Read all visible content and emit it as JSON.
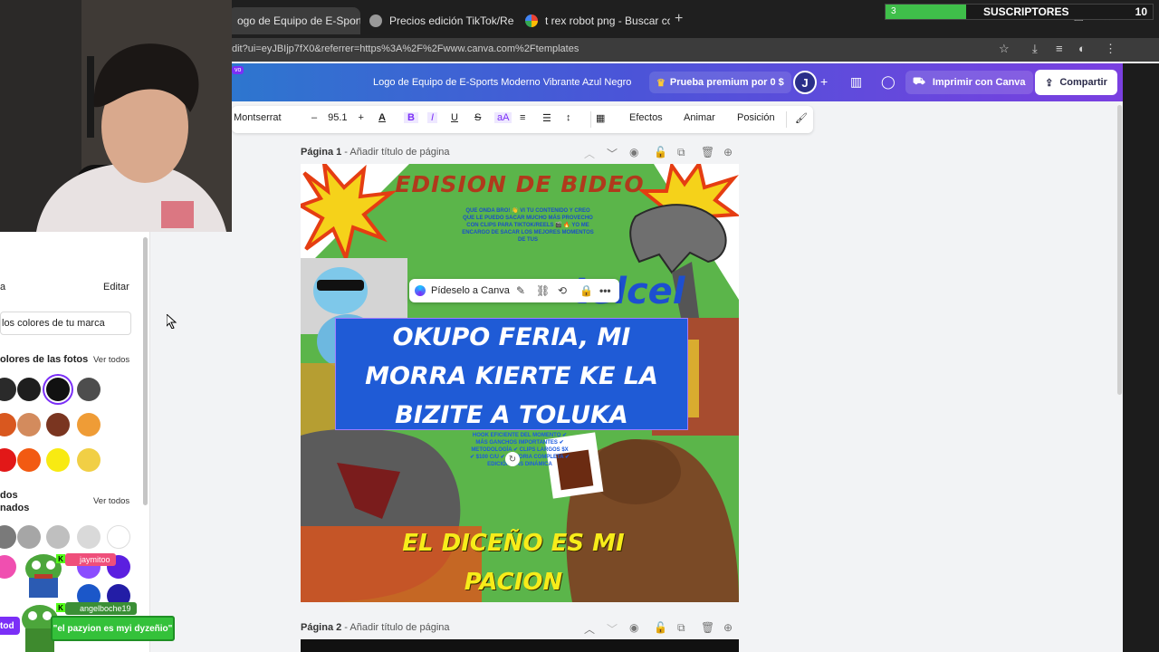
{
  "browser": {
    "tabs": [
      {
        "title": "ogo de Equipo de E-Sports M",
        "active": true
      },
      {
        "title": "Precios edición TikTok/Reels",
        "active": false
      },
      {
        "title": "t rex robot png - Buscar con Go",
        "active": false
      }
    ],
    "url": "dit?ui=eyJBIjp7fX0&referrer=https%3A%2F%2Fwww.canva.com%2Ftemplates"
  },
  "header": {
    "new_badge": "vo",
    "doc_title": "Logo de Equipo de E-Sports Moderno Vibrante Azul Negro",
    "premium_label": "Prueba premium por 0 $",
    "avatar_letter": "J",
    "print_label": "Imprimir con Canva",
    "share_label": "Compartir"
  },
  "toolbar": {
    "font": "Montserrat",
    "font_size": "95.1",
    "effects": "Efectos",
    "animate": "Animar",
    "position": "Posición"
  },
  "panel": {
    "edit_label": "Editar",
    "brand_colors": "los colores de tu marca",
    "photo_colors_title": "olores de las fotos",
    "view_all_1": "Ver todos",
    "all_title_1": "dos",
    "all_title_2": "nados",
    "view_all_2": "Ver todos",
    "bottom_btn": "tod"
  },
  "pages": {
    "page1_label": "Página 1",
    "page1_add": "Añadir título de página",
    "page2_label": "Página 2",
    "page2_add": "Añadir título de página"
  },
  "design": {
    "headline": "EDISION DE BIDEO",
    "small_text": "QUE ONDA BRO! 👋 VI TU CONTENIDO Y CREO QUE LE PUEDO SACAR MUCHO MÁS PROVECHO CON CLIPS PARA TIKTOK/REELS 🎬 🔥 YO ME ENCARGO DE SACAR LOS MEJORES MOMENTOS DE TUS",
    "telcel": "telcel",
    "main_line1": "OKUPO FERIA, MI",
    "main_line2": "MORRA KIERTE KE LA",
    "main_line3": "BIZITE A TOLUKA",
    "list_text": "HOOK EFICIENTE DEL MOMENTO ✔ MÁS GANCHOS IMPORTANTES ✔ METODOLOGÍA ✔ CLIPS LARGOS $X ✔ $100 C/U ✔ HISTORIA COMPLETA ✔ EDICIÓN MÁS DINÁMICA",
    "bottom_line1": "EL DICEÑO ES MI",
    "bottom_line2": "PACION",
    "ask_canva": "Pídeselo a Canva"
  },
  "overlay": {
    "subs_current": "3",
    "subs_title": "SUSCRIPTORES",
    "subs_goal": "10",
    "chat_user1": "jaymitoo",
    "chat_user2": "angelboche19",
    "chat_message": "\"el pazyion es myi dyzeñio\""
  },
  "colors": {
    "canva_gradient_start": "#1c8ac9",
    "canva_gradient_end": "#7a3fe0",
    "design_green": "#5bb54a",
    "highlight_blue": "#1f5bd6",
    "kick_green": "#53fc18"
  }
}
